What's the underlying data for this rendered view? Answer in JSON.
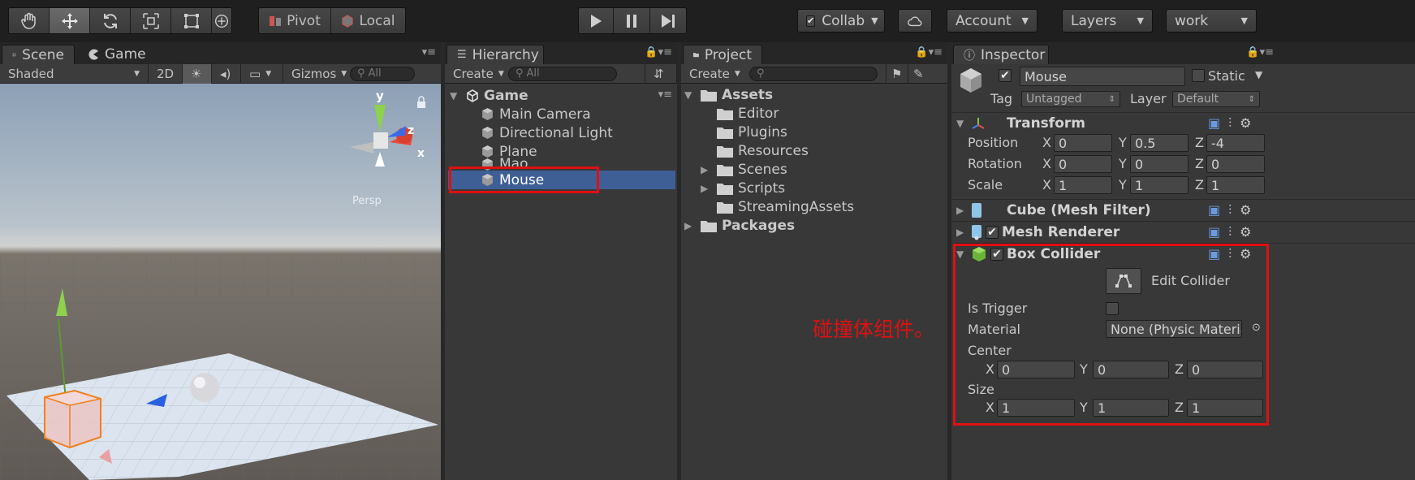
{
  "toolbar": {
    "pivot": "Pivot",
    "local": "Local",
    "collab": "Collab",
    "account": "Account",
    "layers": "Layers",
    "layout": "work"
  },
  "scene": {
    "tab_scene": "Scene",
    "tab_game": "Game",
    "shading": "Shaded",
    "mode_2d": "2D",
    "gizmos": "Gizmos",
    "search_placeholder": "All",
    "gizmo_y": "y",
    "gizmo_z": "z",
    "gizmo_x": "x",
    "persp": "Persp"
  },
  "hierarchy": {
    "tab": "Hierarchy",
    "create": "Create",
    "search_placeholder": "All",
    "root": "Game",
    "items": [
      "Main Camera",
      "Directional Light",
      "Plane",
      "Mao",
      "Mouse"
    ]
  },
  "project": {
    "tab": "Project",
    "create": "Create",
    "assets": "Assets",
    "folders": [
      "Editor",
      "Plugins",
      "Resources",
      "Scenes",
      "Scripts",
      "StreamingAssets"
    ],
    "packages": "Packages"
  },
  "inspector": {
    "tab": "Inspector",
    "object_name": "Mouse",
    "static_label": "Static",
    "tag_label": "Tag",
    "tag_value": "Untagged",
    "layer_label": "Layer",
    "layer_value": "Default",
    "transform": {
      "title": "Transform",
      "position_label": "Position",
      "rotation_label": "Rotation",
      "scale_label": "Scale",
      "position": {
        "x": "0",
        "y": "0.5",
        "z": "-4"
      },
      "rotation": {
        "x": "0",
        "y": "0",
        "z": "0"
      },
      "scale": {
        "x": "1",
        "y": "1",
        "z": "1"
      }
    },
    "mesh_filter_title": "Cube (Mesh Filter)",
    "mesh_renderer_title": "Mesh Renderer",
    "box_collider": {
      "title": "Box Collider",
      "edit_collider": "Edit Collider",
      "is_trigger_label": "Is Trigger",
      "material_label": "Material",
      "material_value": "None (Physic Materia",
      "center_label": "Center",
      "size_label": "Size",
      "center": {
        "x": "0",
        "y": "0",
        "z": "0"
      },
      "size": {
        "x": "1",
        "y": "1",
        "z": "1"
      }
    },
    "axis": {
      "x": "X",
      "y": "Y",
      "z": "Z"
    }
  },
  "annotation": "碰撞体组件。",
  "colors": {
    "highlight_red": "#e01010",
    "selection_blue": "#3e5f96",
    "panel_bg": "#383838"
  }
}
